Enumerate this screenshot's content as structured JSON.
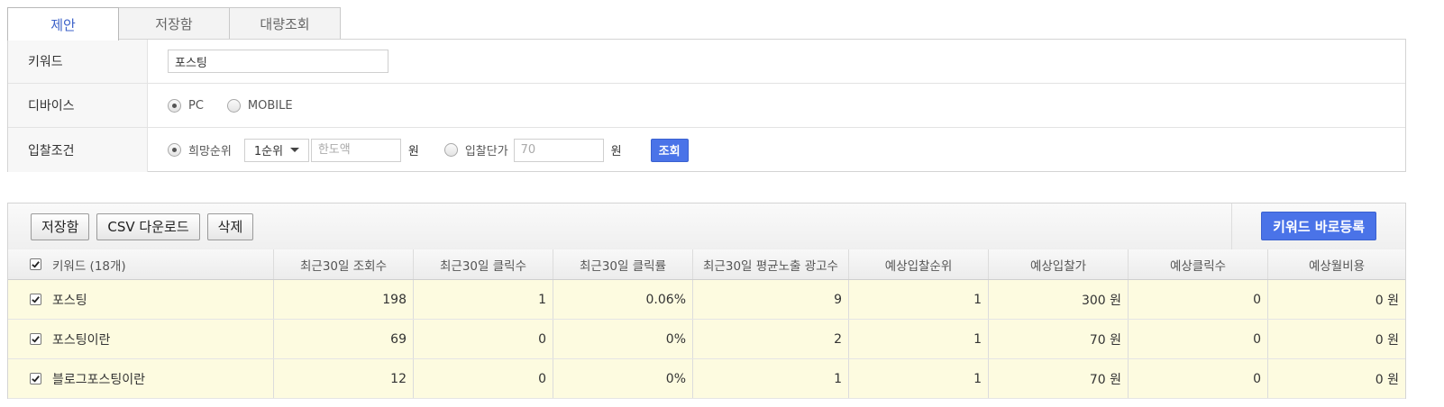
{
  "tabs": [
    {
      "label": "제안",
      "active": true
    },
    {
      "label": "저장함",
      "active": false
    },
    {
      "label": "대량조회",
      "active": false
    }
  ],
  "form": {
    "keyword": {
      "label": "키워드",
      "value": "포스팅"
    },
    "device": {
      "label": "디바이스",
      "options": [
        {
          "label": "PC",
          "checked": true
        },
        {
          "label": "MOBILE",
          "checked": false
        }
      ]
    },
    "bid": {
      "label": "입찰조건",
      "rank_option": {
        "label": "희망순위",
        "checked": true
      },
      "rank_select": "1순위",
      "limit_placeholder": "한도액",
      "unit": "원",
      "price_option": {
        "label": "입찰단가",
        "checked": false
      },
      "price_value": "70",
      "query_button": "조회"
    }
  },
  "toolbar": {
    "save_label": "저장함",
    "csv_label": "CSV 다운로드",
    "delete_label": "삭제",
    "register_label": "키워드 바로등록"
  },
  "table": {
    "headers": [
      "키워드 (18개)",
      "최근30일 조회수",
      "최근30일 클릭수",
      "최근30일 클릭률",
      "최근30일 평균노출 광고수",
      "예상입찰순위",
      "예상입찰가",
      "예상클릭수",
      "예상월비용"
    ],
    "rows": [
      {
        "keyword": "포스팅",
        "views": "198",
        "clicks": "1",
        "ctr": "0.06%",
        "ads": "9",
        "rank": "1",
        "bid": "300 원",
        "est_clicks": "0",
        "cost": "0 원"
      },
      {
        "keyword": "포스팅이란",
        "views": "69",
        "clicks": "0",
        "ctr": "0%",
        "ads": "2",
        "rank": "1",
        "bid": "70 원",
        "est_clicks": "0",
        "cost": "0 원"
      },
      {
        "keyword": "블로그포스팅이란",
        "views": "12",
        "clicks": "0",
        "ctr": "0%",
        "ads": "1",
        "rank": "1",
        "bid": "70 원",
        "est_clicks": "0",
        "cost": "0 원"
      }
    ]
  },
  "colors": {
    "accent": "#4a73e8",
    "active_tab_text": "#3d62c8",
    "row_highlight": "#fdfbe0"
  }
}
